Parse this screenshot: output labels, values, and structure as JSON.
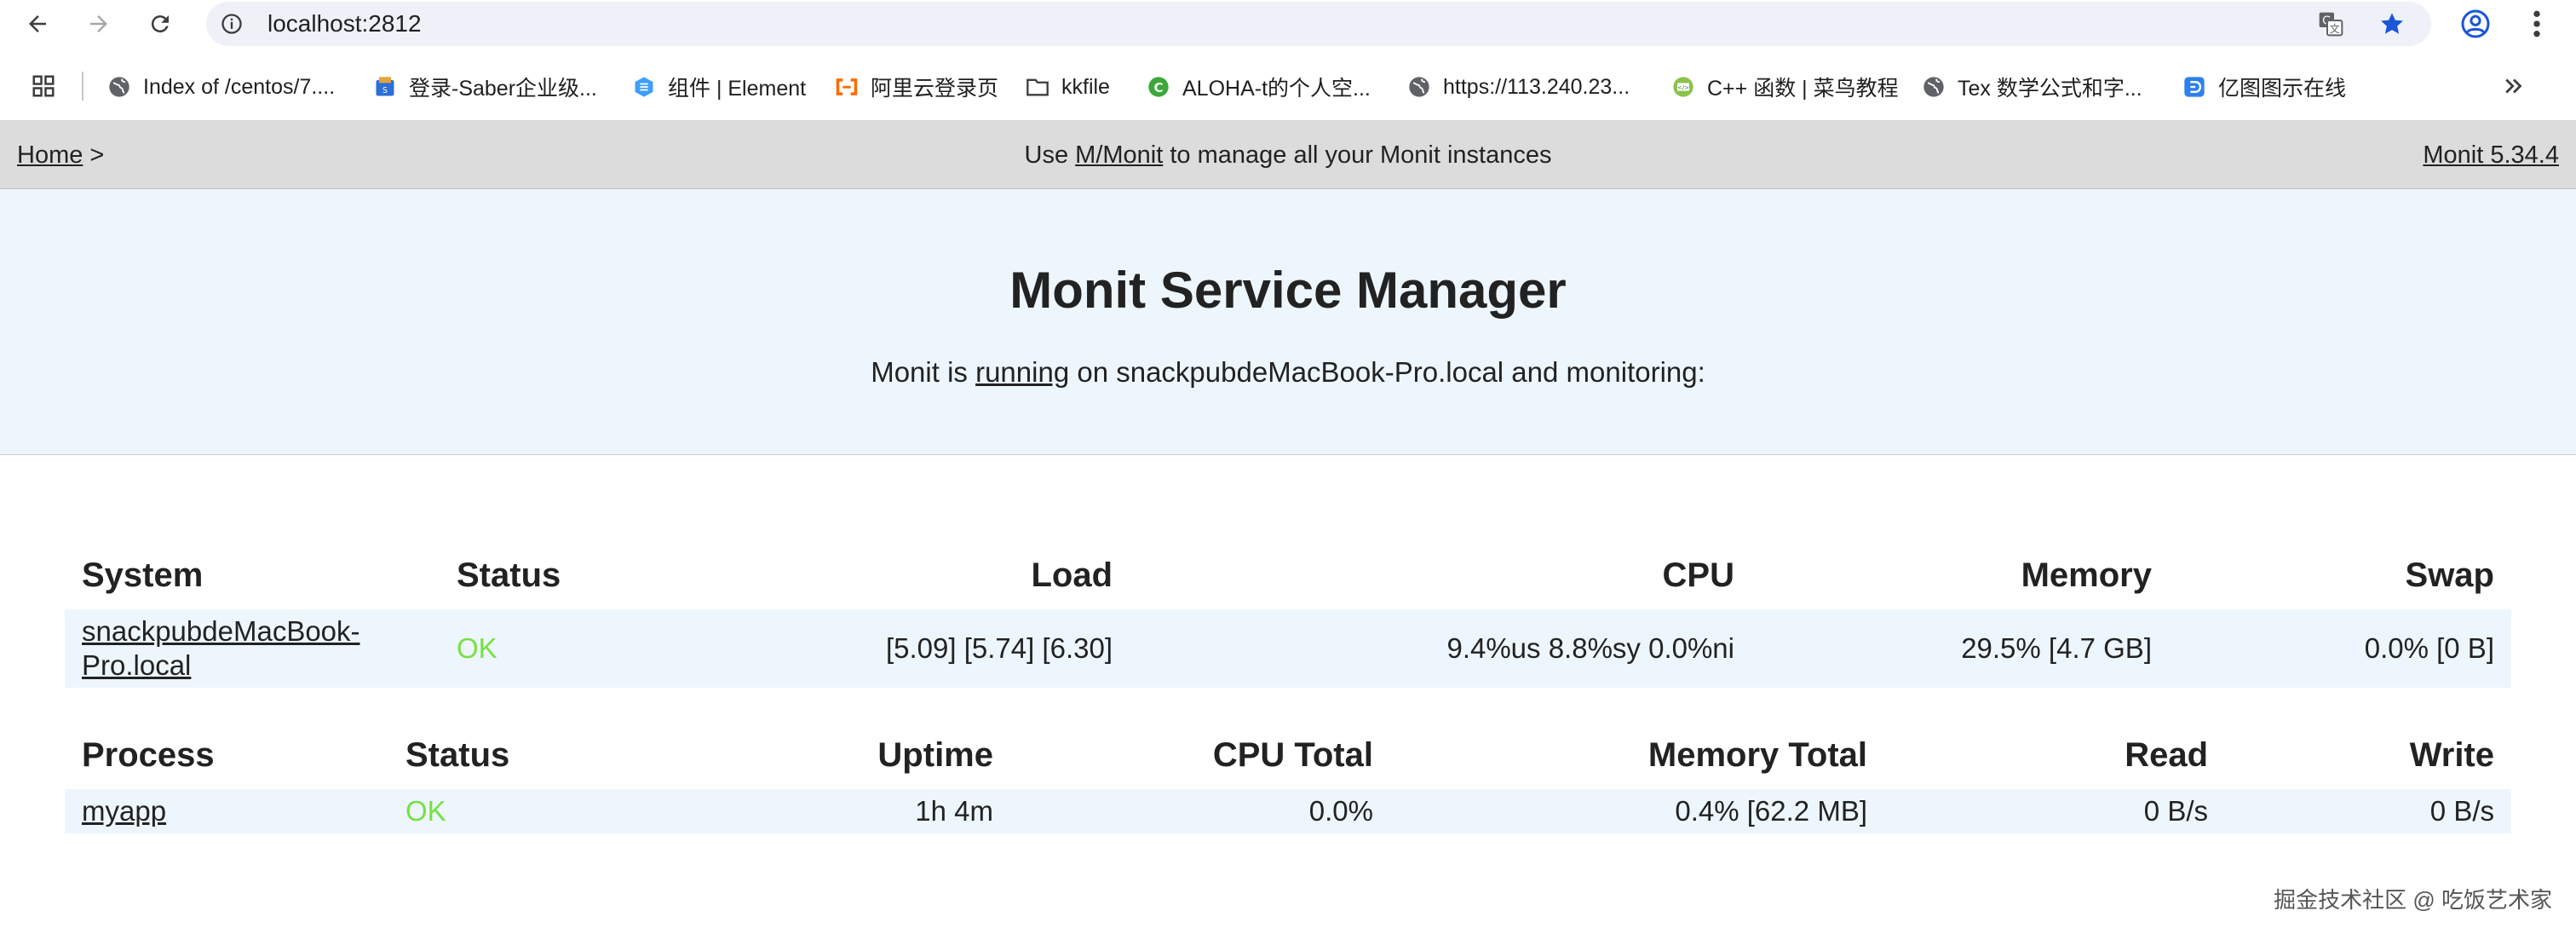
{
  "browser": {
    "url": "localhost:2812",
    "bookmarks": [
      {
        "label": "Index of /centos/7....",
        "icon": "globe-icon"
      },
      {
        "label": "登录-Saber企业级...",
        "icon": "saber-icon"
      },
      {
        "label": "组件 | Element",
        "icon": "element-icon"
      },
      {
        "label": "阿里云登录页",
        "icon": "aliyun-icon"
      },
      {
        "label": "kkfile",
        "icon": "folder-icon"
      },
      {
        "label": "ALOHA-t的个人空...",
        "icon": "csdn-icon"
      },
      {
        "label": "https://113.240.23...",
        "icon": "globe-icon"
      },
      {
        "label": "C++ 函数 | 菜鸟教程",
        "icon": "runoob-icon"
      },
      {
        "label": "Tex 数学公式和字...",
        "icon": "globe-icon"
      },
      {
        "label": "亿图图示在线",
        "icon": "edraw-icon"
      }
    ]
  },
  "header": {
    "home_label": "Home",
    "breadcrumb_sep": " >",
    "message_prefix": "Use ",
    "mmonit_link": "M/Monit",
    "message_suffix": " to manage all your Monit instances",
    "version": "Monit 5.34.4"
  },
  "hero": {
    "title": "Monit Service Manager",
    "status_prefix": "Monit is ",
    "status_link": "running",
    "status_suffix": " on snackpubdeMacBook-Pro.local and monitoring:"
  },
  "system_table": {
    "headers": {
      "system": "System",
      "status": "Status",
      "load": "Load",
      "cpu": "CPU",
      "memory": "Memory",
      "swap": "Swap"
    },
    "row": {
      "name_line1": "snackpubdeMacBook-",
      "name_line2": "Pro.local",
      "status": "OK",
      "load": "[5.09] [5.74] [6.30]",
      "cpu": "9.4%us 8.8%sy 0.0%ni",
      "memory": "29.5% [4.7 GB]",
      "swap": "0.0% [0 B]"
    }
  },
  "process_table": {
    "headers": {
      "process": "Process",
      "status": "Status",
      "uptime": "Uptime",
      "cpu_total": "CPU Total",
      "memory_total": "Memory Total",
      "read": "Read",
      "write": "Write"
    },
    "row": {
      "name": "myapp",
      "status": "OK",
      "uptime": "1h 4m",
      "cpu_total": "0.0%",
      "memory_total": "0.4% [62.2 MB]",
      "read": "0 B/s",
      "write": "0 B/s"
    }
  },
  "colors": {
    "ok": "#77e043",
    "hero_bg": "#eef6fd",
    "header_bg": "#dcdcdc",
    "star": "#1a56d6"
  },
  "watermark": "掘金技术社区 @ 吃饭艺术家"
}
